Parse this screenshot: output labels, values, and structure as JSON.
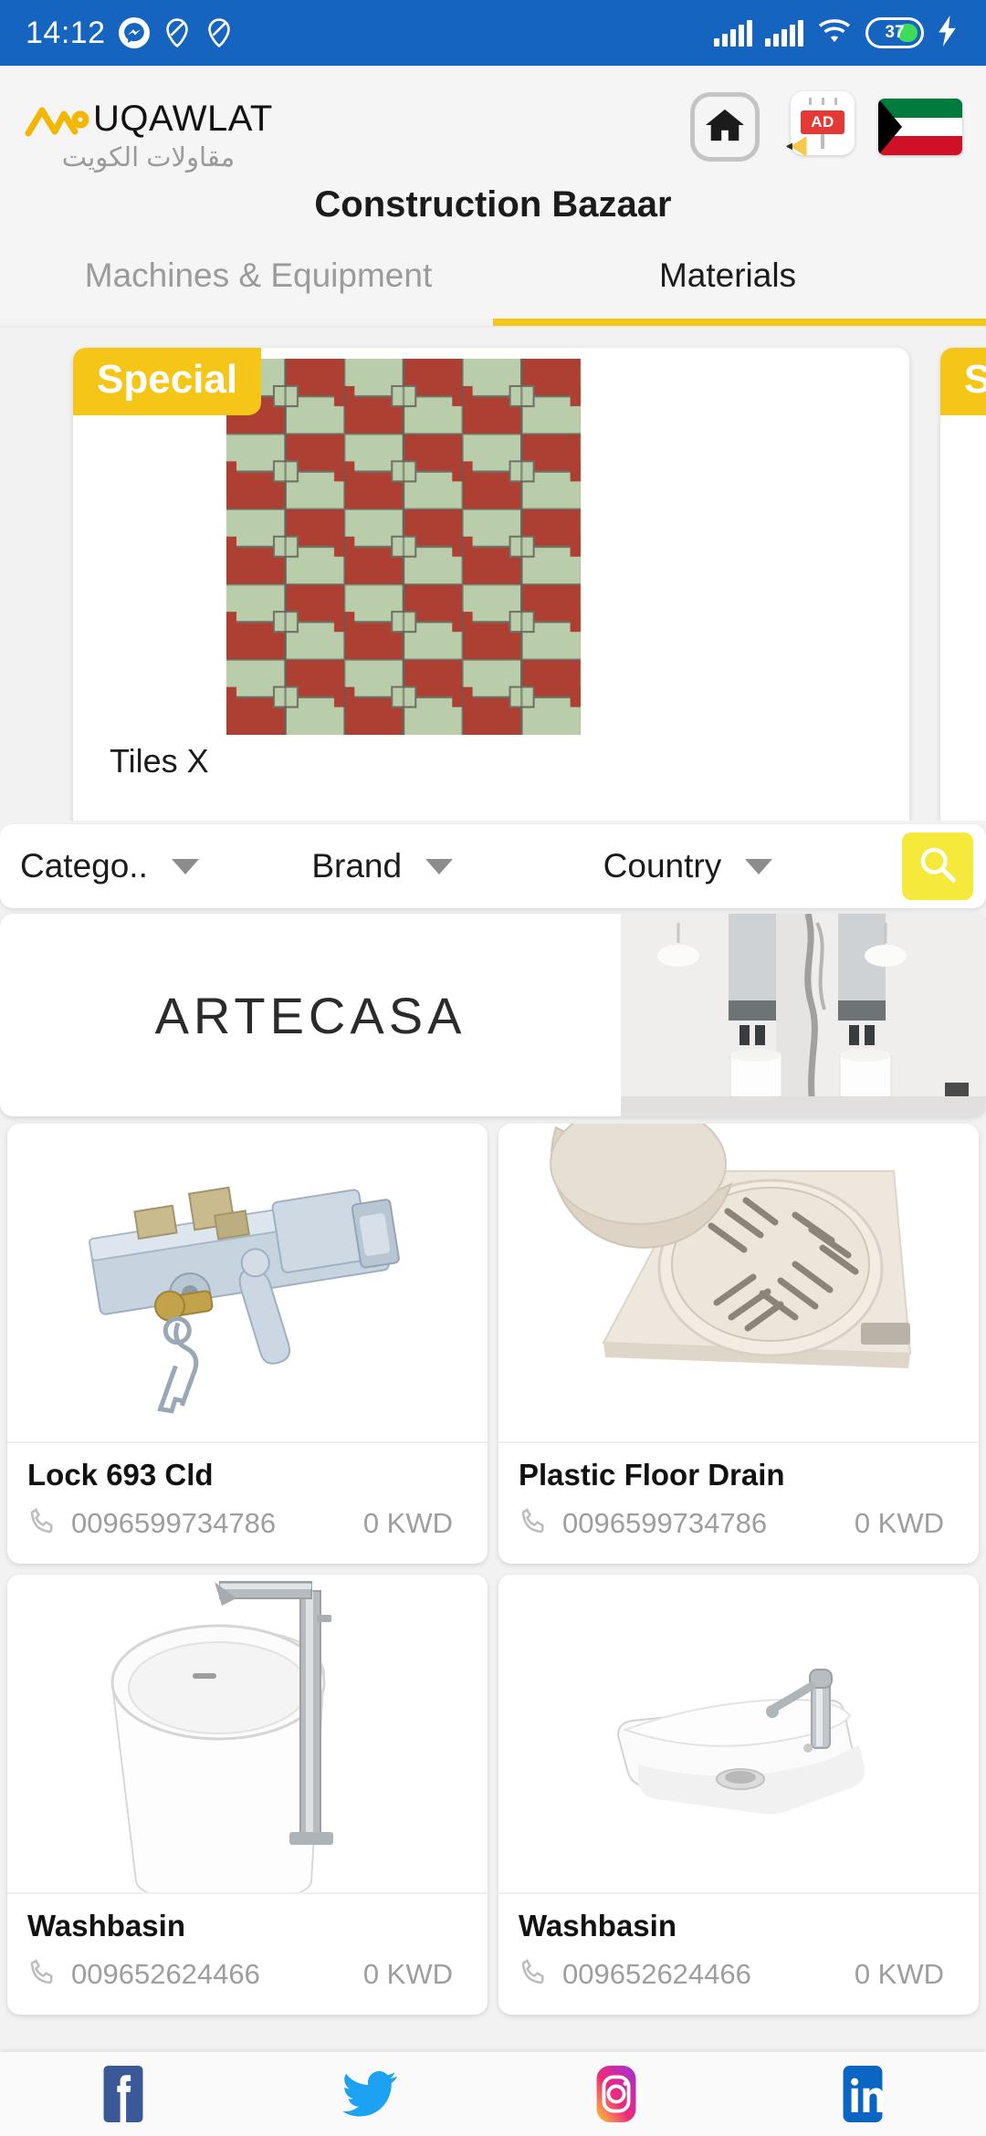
{
  "status_bar": {
    "time": "14:12",
    "battery_percent": "37",
    "icons": [
      "messenger-icon",
      "do-not-disturb-icon",
      "do-not-disturb-icon",
      "signal-icon",
      "signal-icon",
      "wifi-icon",
      "battery-icon",
      "charging-bolt-icon"
    ]
  },
  "app_bar": {
    "logo_text": "UQAWLAT",
    "logo_arabic": "مقاولات الكويت",
    "home_icon": "home-icon",
    "ad_icon": "ad-billboard-icon",
    "ad_label": "AD",
    "flag_icon": "kuwait-flag-icon",
    "title": "Construction Bazaar"
  },
  "tabs": [
    {
      "label": "Machines & Equipment",
      "active": false
    },
    {
      "label": "Materials",
      "active": true
    }
  ],
  "promos": [
    {
      "badge": "Special",
      "label": "Tiles X"
    },
    {
      "badge": "Special",
      "label": ""
    }
  ],
  "filters": {
    "items": [
      {
        "label": "Catego..",
        "name": "category"
      },
      {
        "label": "Brand",
        "name": "brand"
      },
      {
        "label": "Country",
        "name": "country"
      }
    ],
    "search_icon": "search-icon"
  },
  "ad_banner": {
    "brand": "ARTECASA",
    "image_alt": "bathroom-marble-photo"
  },
  "products": [
    {
      "name": "Lock 693 Cld",
      "phone": "0096599734786",
      "price": "0 KWD",
      "image": "door-lock-photo"
    },
    {
      "name": "Plastic Floor Drain",
      "phone": "0096599734786",
      "price": "0 KWD",
      "image": "floor-drain-photo"
    },
    {
      "name": "Washbasin",
      "phone": "009652624466",
      "price": "0 KWD",
      "image": "pedestal-washbasin-photo"
    },
    {
      "name": "Washbasin",
      "phone": "009652624466",
      "price": "0 KWD",
      "image": "counter-washbasin-photo"
    }
  ],
  "social": [
    {
      "name": "facebook",
      "label": "f"
    },
    {
      "name": "twitter",
      "label": ""
    },
    {
      "name": "instagram",
      "label": ""
    },
    {
      "name": "linkedin",
      "label": "in"
    }
  ],
  "colors": {
    "status_bar": "#1565c0",
    "accent_yellow": "#f5c518",
    "search_yellow": "#f5ea3c",
    "tab_active_text": "#1b1b1b",
    "tab_inactive_text": "#9b9b9b"
  }
}
